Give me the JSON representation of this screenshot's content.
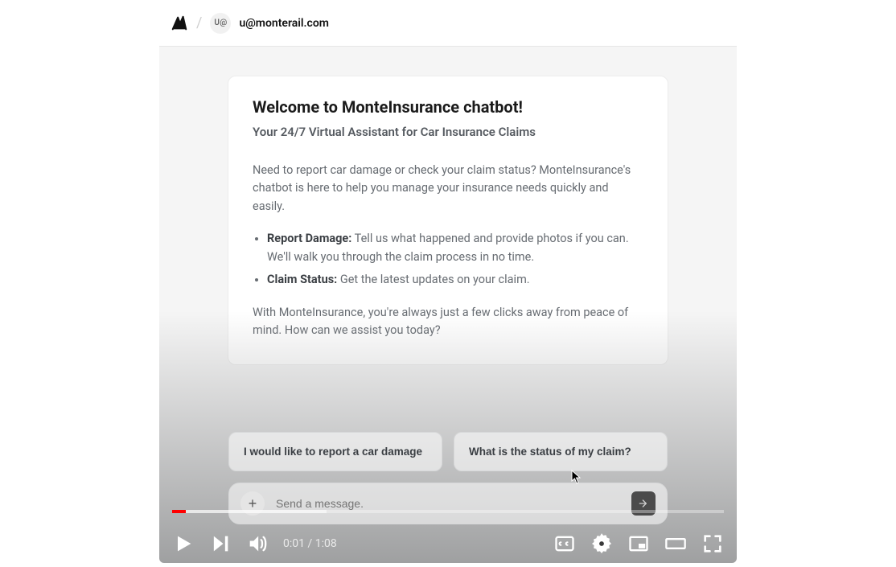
{
  "header": {
    "avatar_text": "U@",
    "email": "u@monterail.com"
  },
  "card": {
    "title": "Welcome to MonteInsurance chatbot!",
    "subtitle": "Your 24/7 Virtual Assistant for Car Insurance Claims",
    "intro": "Need to report car damage or check your claim status? MonteInsurance's chatbot is here to help you manage your insurance needs quickly and easily.",
    "bullets": [
      {
        "label": "Report Damage:",
        "text": " Tell us what happened and provide photos if you can. We'll walk you through the claim process in no time."
      },
      {
        "label": "Claim Status:",
        "text": " Get the latest updates on your claim."
      }
    ],
    "outro": "With MonteInsurance, you're always just a few clicks away from peace of mind. How can we assist you today?"
  },
  "suggestions": [
    "I would like to report a car damage",
    "What is the status of my claim?"
  ],
  "composer": {
    "placeholder": "Send a message."
  },
  "player": {
    "current": "0:01",
    "duration": "1:08",
    "played_pct": 2.5,
    "buffer_pct": 28
  }
}
